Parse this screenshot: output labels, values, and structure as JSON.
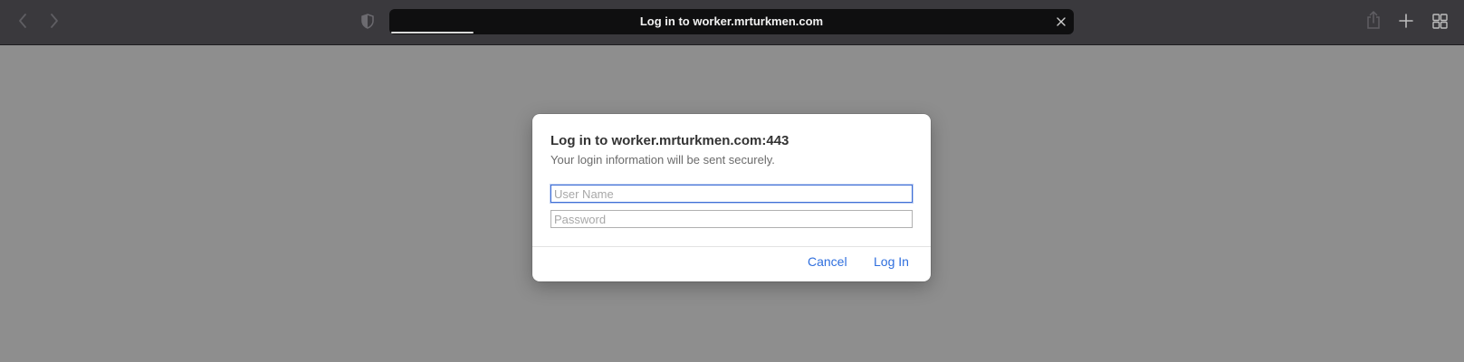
{
  "colors": {
    "toolbar_bg": "#3a393d",
    "page_bg": "#8e8e8e",
    "address_bg": "#0f0f10",
    "accent_link": "#2f6fde",
    "field_focus": "#3f6fd6"
  },
  "toolbar": {
    "icons": [
      "chevron-left-icon",
      "chevron-right-icon",
      "shield-icon",
      "share-icon",
      "plus-icon",
      "tab-overview-icon"
    ],
    "address": {
      "text": "Log in to worker.mrturkmen.com",
      "load_progress": 0.12,
      "stop_icon": "close-icon"
    }
  },
  "dialog": {
    "title": "Log in to worker.mrturkmen.com:443",
    "subtitle": "Your login information will be sent securely.",
    "username": {
      "placeholder": "User Name",
      "value": ""
    },
    "password": {
      "placeholder": "Password",
      "value": ""
    },
    "cancel_label": "Cancel",
    "login_label": "Log In"
  }
}
